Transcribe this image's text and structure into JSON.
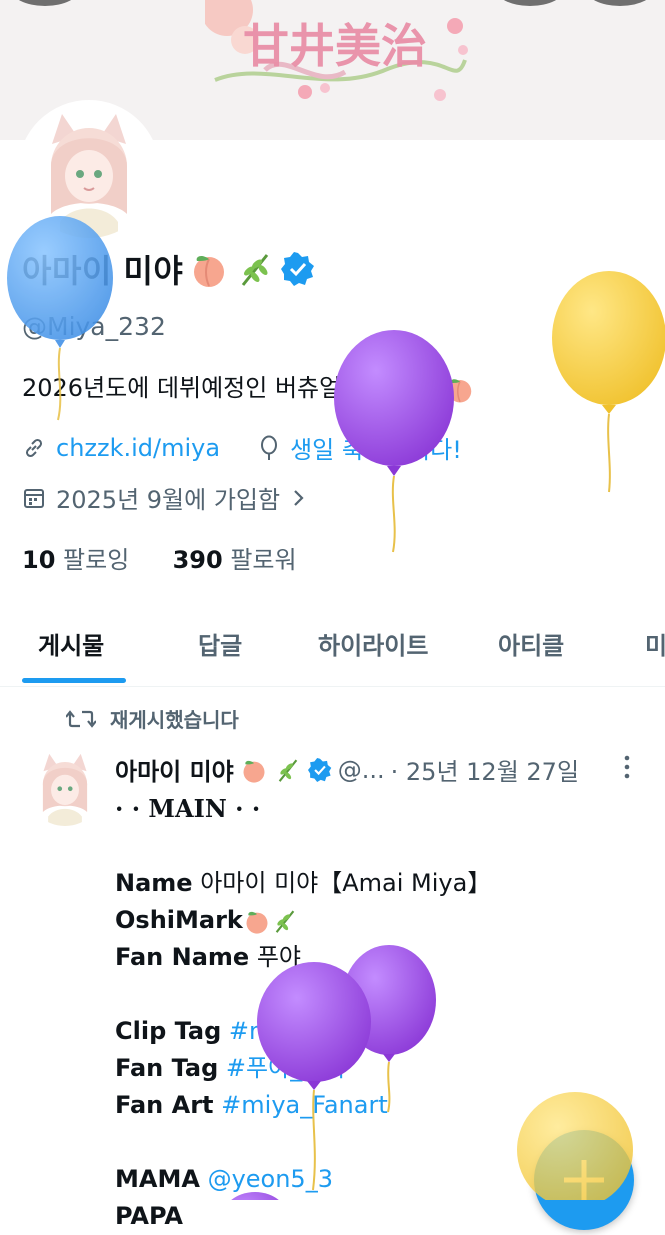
{
  "banner": {
    "logo_text": "甘井美治"
  },
  "profile": {
    "display_name": "아마이 미야",
    "handle": "@Miya_232",
    "bio": "2026년도에 데뷔예정인 버츄얼 스트리머",
    "link": "chzzk.id/miya",
    "birthday": "생일 축하합니다!",
    "joined": "2025년 9월에 가입함",
    "following_count": "10",
    "following_label": "팔로잉",
    "followers_count": "390",
    "followers_label": "팔로워"
  },
  "tabs": [
    {
      "label": "게시물",
      "active": true
    },
    {
      "label": "답글"
    },
    {
      "label": "하이라이트"
    },
    {
      "label": "아티클"
    },
    {
      "label": "미"
    }
  ],
  "post": {
    "repost_label": "재게시했습니다",
    "author_name": "아마이 미야",
    "author_handle": "@...",
    "date": "· 25년 12월 27일",
    "main_line": "· · MAIN · ·",
    "name_key": "Name",
    "name_value": "아마이 미야【Amai Miya】",
    "oshimark_key": "OshiMark",
    "fanname_key": "Fan Name",
    "fanname_value": "푸야",
    "cliptag_key": "Clip Tag",
    "cliptag_value": "#miya_clip",
    "fantag_key": "Fan Tag",
    "fantag_value": "#푸야_미야",
    "fanart_key": "Fan Art",
    "fanart_value": "#miya_Fanart",
    "mama_key": "MAMA",
    "mama_value": "@yeon5_3",
    "papa_key": "PAPA"
  },
  "icons": {
    "verified": "verified-badge-icon",
    "link": "link-icon",
    "balloon": "balloon-icon",
    "calendar": "calendar-icon",
    "repost": "repost-icon",
    "more": "more-vertical-icon",
    "compose": "compose-plus-icon"
  },
  "colors": {
    "accent": "#1d9bf0",
    "secondary_text": "#536471",
    "balloon_blue": "#4aa3f0",
    "balloon_purple": "#9a44e0",
    "balloon_yellow": "#f6cf3a"
  }
}
